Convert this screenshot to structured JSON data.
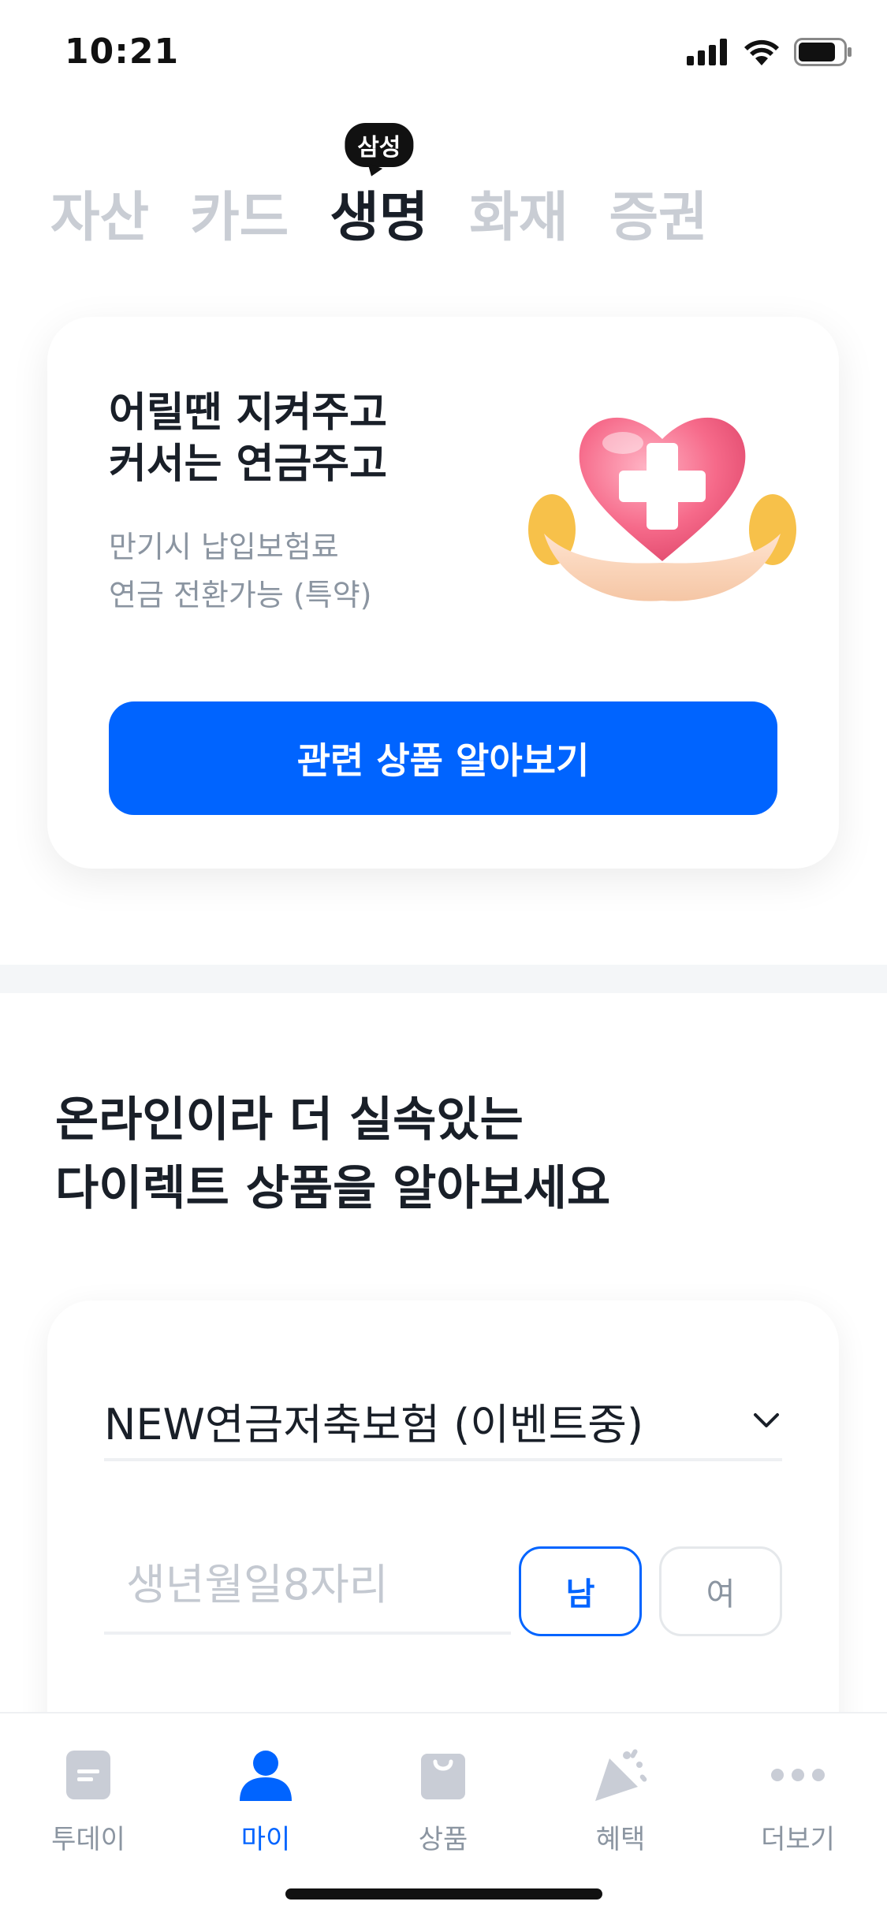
{
  "status_bar": {
    "time": "10:21"
  },
  "tabs": {
    "items": [
      {
        "label": "자산"
      },
      {
        "label": "카드"
      },
      {
        "label": "생명"
      },
      {
        "label": "화재"
      },
      {
        "label": "증권"
      }
    ],
    "active_index": 2,
    "active_badge": "삼성"
  },
  "promo": {
    "title_line1": "어릴땐 지켜주고",
    "title_line2": "커서는 연금주고",
    "sub_line1": "만기시 납입보험료",
    "sub_line2": "연금 전환가능 (특약)",
    "button_label": "관련 상품 알아보기"
  },
  "section": {
    "title_line1": "온라인이라 더 실속있는",
    "title_line2": "다이렉트 상품을 알아보세요"
  },
  "calculator": {
    "product_selected": "NEW연금저축보험 (이벤트중)",
    "birth_placeholder": "생년월일8자리",
    "gender_male": "남",
    "gender_female": "여",
    "selected_gender": "남"
  },
  "bottom_nav": {
    "items": [
      {
        "label": "투데이",
        "icon": "today-icon"
      },
      {
        "label": "마이",
        "icon": "person-icon"
      },
      {
        "label": "상품",
        "icon": "shopping-bag-icon"
      },
      {
        "label": "혜택",
        "icon": "party-popper-icon"
      },
      {
        "label": "더보기",
        "icon": "more-dots-icon"
      }
    ],
    "active_index": 1
  },
  "colors": {
    "accent": "#0064ff",
    "text_primary": "#191f28",
    "text_secondary": "#8b95a1",
    "tab_inactive": "#c9cdd4"
  }
}
